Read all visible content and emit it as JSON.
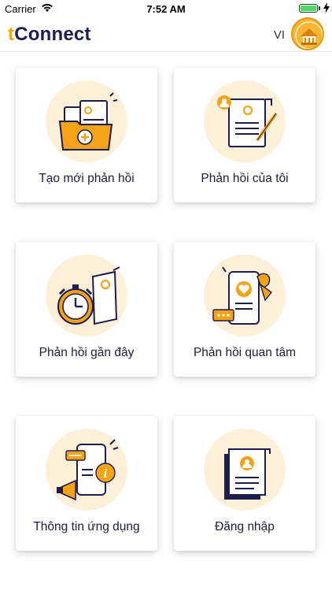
{
  "status_bar": {
    "carrier": "Carrier",
    "time": "7:52 AM"
  },
  "header": {
    "brand_prefix": "t",
    "brand_rest": "Connect",
    "language": "VI"
  },
  "menu": [
    {
      "label": "Tạo mới phản hồi",
      "icon": "new-feedback-folder-icon"
    },
    {
      "label": "Phản hồi của tôi",
      "icon": "my-feedback-document-icon"
    },
    {
      "label": "Phản hồi gần đây",
      "icon": "recent-feedback-clock-icon"
    },
    {
      "label": "Phản hồi quan tâm",
      "icon": "favorite-feedback-phone-icon"
    },
    {
      "label": "Thông tin ứng dụng",
      "icon": "app-info-megaphone-icon"
    },
    {
      "label": "Đăng nhập",
      "icon": "login-profile-card-icon"
    }
  ],
  "colors": {
    "accent": "#f5a316",
    "brand": "#1d1d4f",
    "circle": "#fdf0d8"
  }
}
